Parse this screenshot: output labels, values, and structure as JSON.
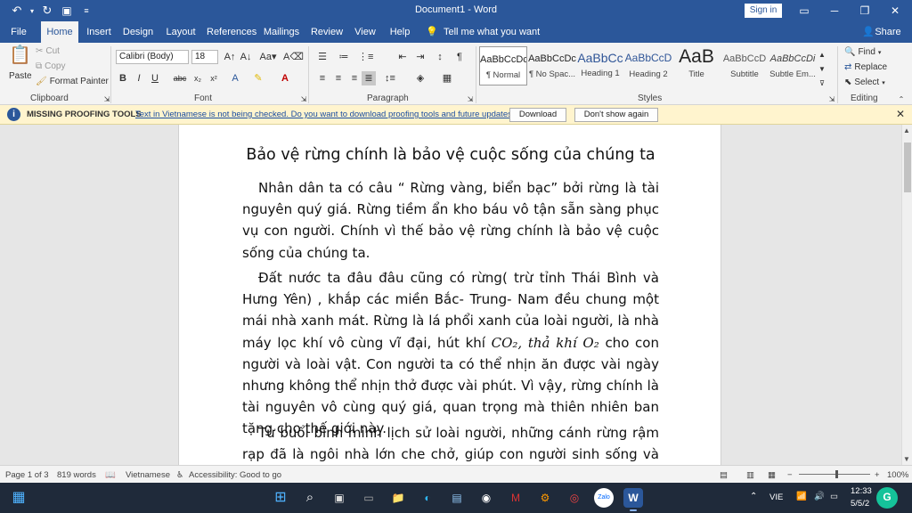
{
  "titlebar": {
    "title": "Document1 - Word",
    "sign_in": "Sign in",
    "quick_access": [
      "undo-icon",
      "redo-icon",
      "save-icon",
      "customize-icon"
    ]
  },
  "tabs": [
    {
      "label": "File"
    },
    {
      "label": "Home",
      "active": true
    },
    {
      "label": "Insert"
    },
    {
      "label": "Design"
    },
    {
      "label": "Layout"
    },
    {
      "label": "References"
    },
    {
      "label": "Mailings"
    },
    {
      "label": "Review"
    },
    {
      "label": "View"
    },
    {
      "label": "Help"
    }
  ],
  "tell_me": "Tell me what you want to do",
  "share": "Share",
  "ribbon": {
    "clipboard": {
      "label": "Clipboard",
      "paste": "Paste",
      "cut": "Cut",
      "copy": "Copy",
      "format_painter": "Format Painter"
    },
    "font": {
      "label": "Font",
      "font_name": "Calibri (Body)",
      "font_size": "18"
    },
    "paragraph": {
      "label": "Paragraph"
    },
    "styles": {
      "label": "Styles",
      "items": [
        {
          "preview": "AaBbCcDc",
          "name": "¶ Normal"
        },
        {
          "preview": "AaBbCcDc",
          "name": "¶ No Spac..."
        },
        {
          "preview": "AaBbCc",
          "name": "Heading 1"
        },
        {
          "preview": "AaBbCcD",
          "name": "Heading 2"
        },
        {
          "preview": "AaB",
          "name": "Title"
        },
        {
          "preview": "AaBbCcD",
          "name": "Subtitle"
        },
        {
          "preview": "AaBbCcDi",
          "name": "Subtle Em..."
        }
      ]
    },
    "editing": {
      "label": "Editing",
      "find": "Find",
      "replace": "Replace",
      "select": "Select"
    }
  },
  "message_bar": {
    "title": "MISSING PROOFING TOOLS",
    "text": "Text in Vietnamese is not being checked. Do you want to download proofing tools and future updates?",
    "download": "Download",
    "dont_show": "Don't show again"
  },
  "document": {
    "heading": "Bảo vệ rừng chính là bảo vệ cuộc sống của chúng ta",
    "para1": "Nhân dân ta có câu “ Rừng vàng, biển bạc” bởi rừng là tài nguyên quý giá. Rừng tiềm ẩn kho báu vô tận sẵn sàng phục vụ con người. Chính vì thế bảo vệ rừng chính là bảo vệ cuộc sống của chúng ta.",
    "para2_a": "Đất nước ta đâu đâu cũng có rừng( trừ tỉnh Thái Bình và Hưng Yên) , khắp các miền Bắc- Trung- Nam đều chung một mái nhà xanh mát. Rừng là lá phổi xanh của loài người, là nhà máy lọc khí vô cùng vĩ đại, hút khí ",
    "para2_math": "CO₂, thả khí O₂",
    "para2_b": " cho con người và loài vật. Con người ta có thể nhịn ăn được vài ngày nhưng không thể nhịn thở được vài phút. Vì vậy, rừng chính là tài nguyên vô cùng quý giá, quan trọng mà thiên nhiên ban tặng cho thế giới này.",
    "para3": "Từ buổi bình minh lịch sử loài người, những cánh rừng rậm rạp đã là ngôi nhà lớn che chở, giúp con người sinh sống và tiến"
  },
  "statusbar": {
    "page": "Page 1 of 3",
    "words": "819 words",
    "language": "Vietnamese",
    "accessibility": "Accessibility: Good to go",
    "zoom": "100%"
  },
  "taskbar": {
    "lang": "VIE",
    "time": "12:33",
    "date": "5/5/2"
  },
  "colors": {
    "accent": "#2b579a",
    "message_bar": "#fff4ce",
    "taskbar": "#1f2a3a"
  }
}
